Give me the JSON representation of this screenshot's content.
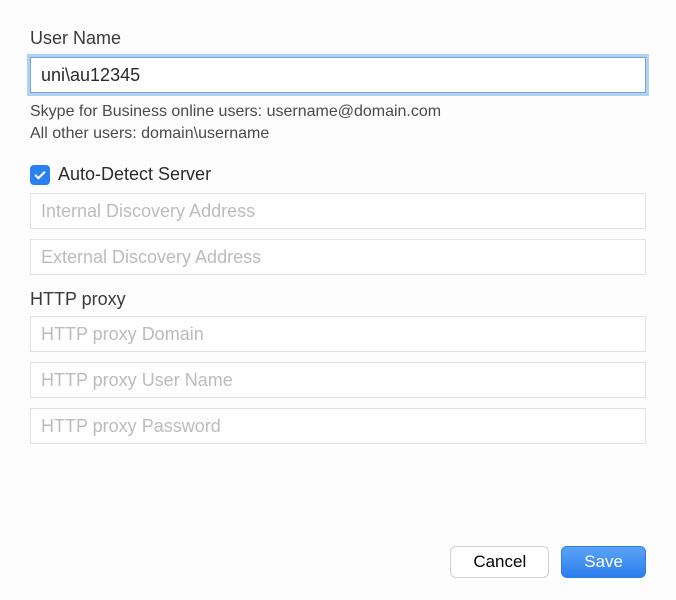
{
  "userName": {
    "label": "User Name",
    "value": "uni\\au12345",
    "hintLine1": "Skype for Business online users: username@domain.com",
    "hintLine2": "All other users: domain\\username"
  },
  "autoDetect": {
    "label": "Auto-Detect Server",
    "checked": true
  },
  "internalDiscovery": {
    "placeholder": "Internal Discovery Address",
    "value": ""
  },
  "externalDiscovery": {
    "placeholder": "External Discovery Address",
    "value": ""
  },
  "httpProxy": {
    "label": "HTTP proxy",
    "domain": {
      "placeholder": "HTTP proxy Domain",
      "value": ""
    },
    "user": {
      "placeholder": "HTTP proxy User Name",
      "value": ""
    },
    "pass": {
      "placeholder": "HTTP proxy Password",
      "value": ""
    }
  },
  "buttons": {
    "cancel": "Cancel",
    "save": "Save"
  }
}
